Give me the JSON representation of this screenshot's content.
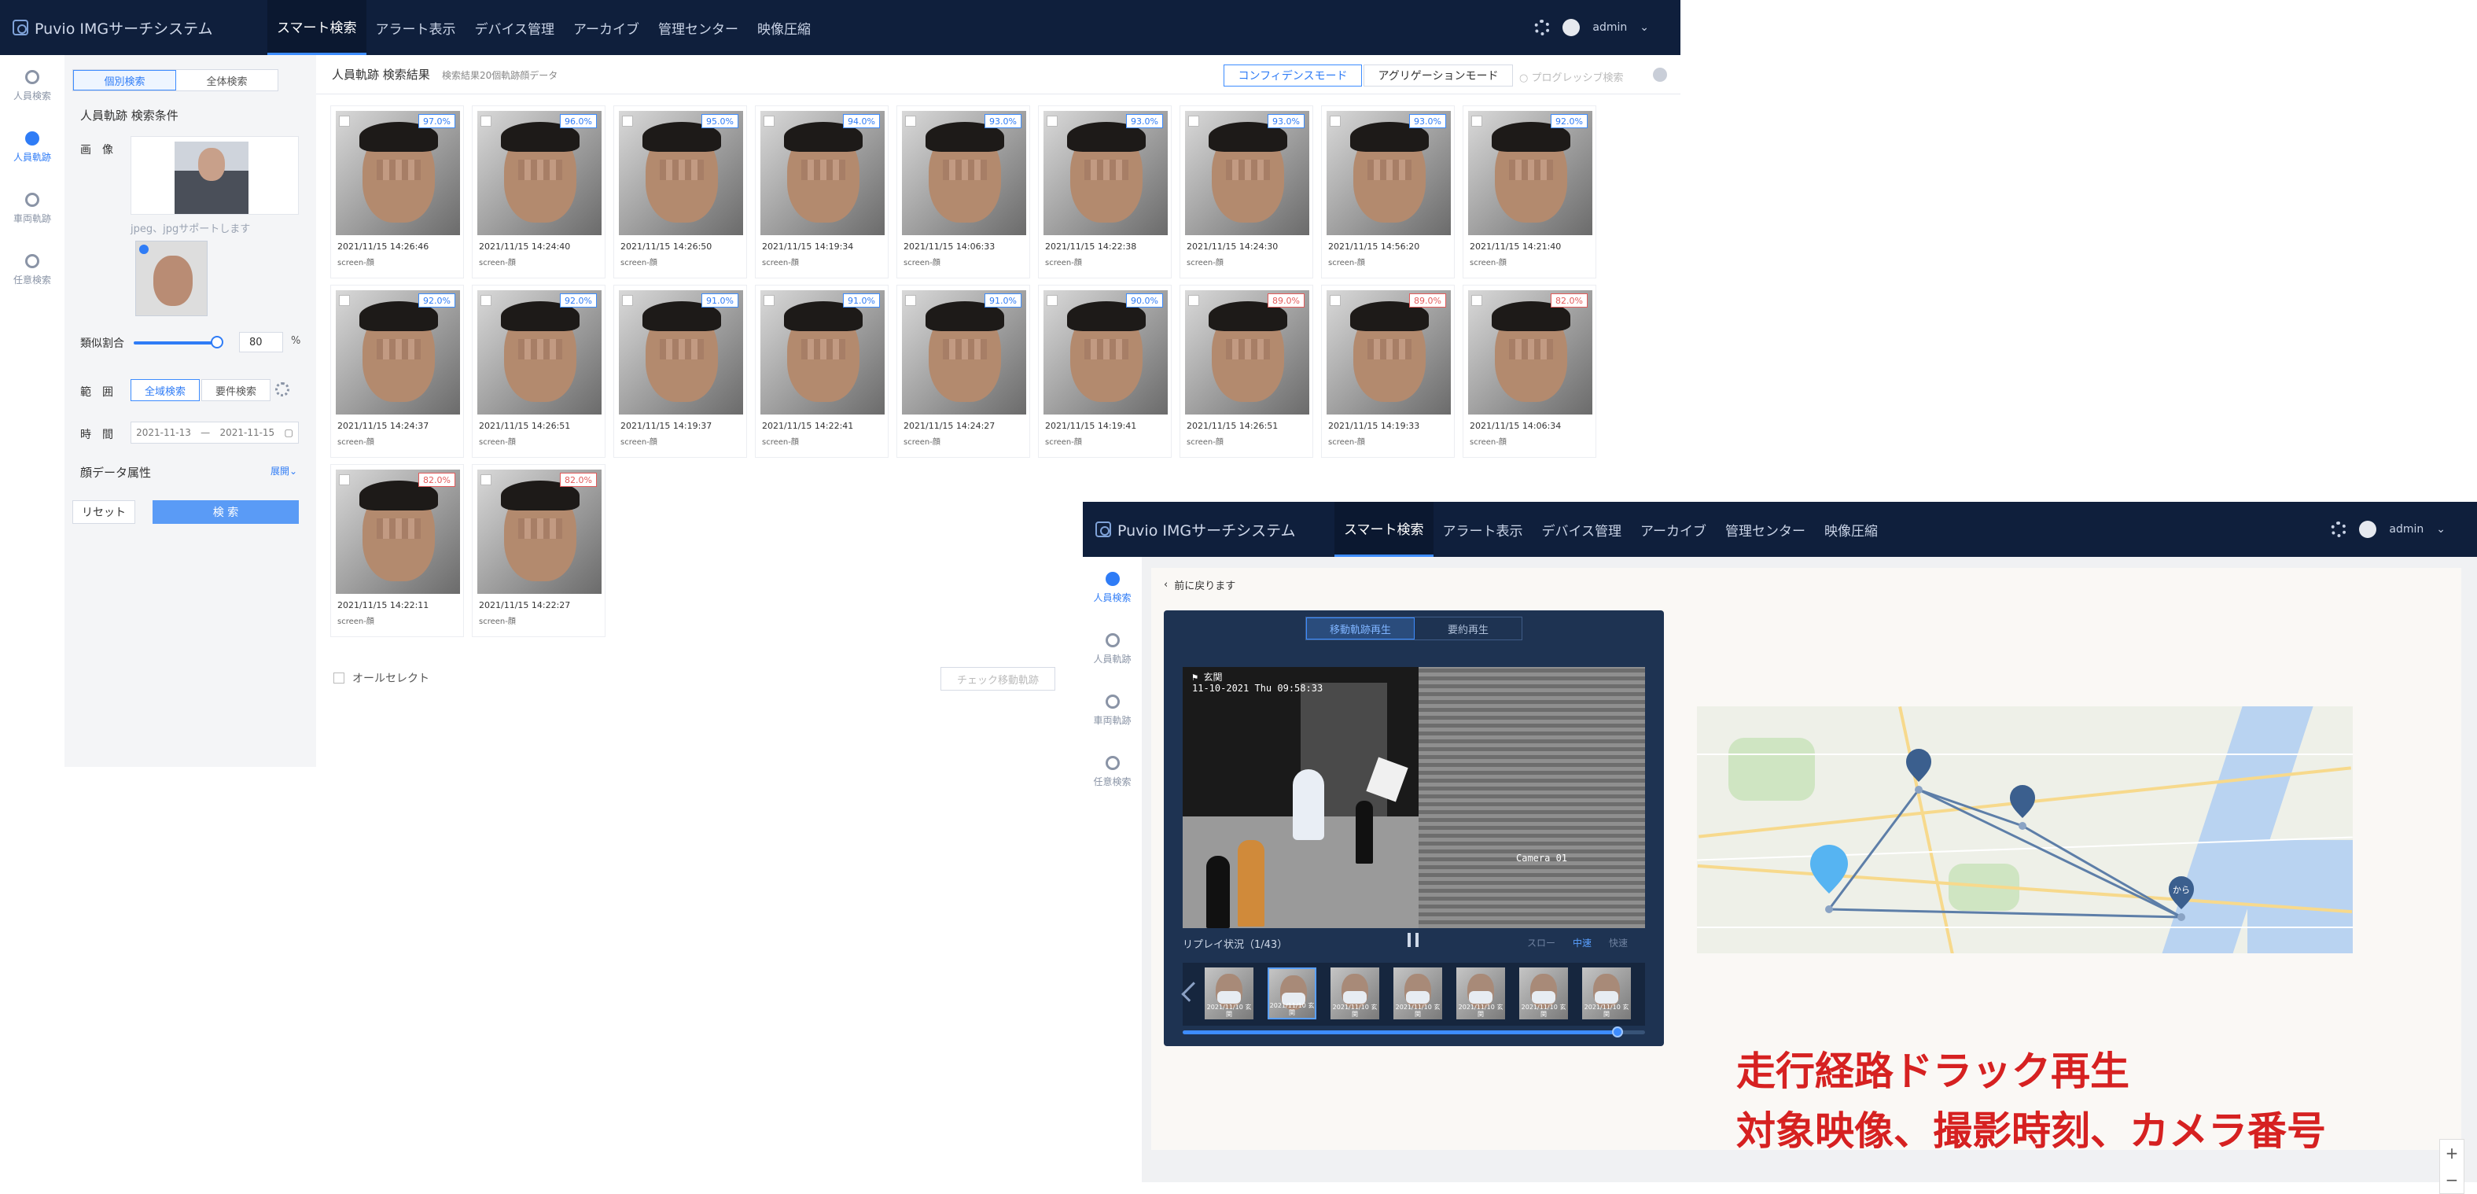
{
  "app": {
    "title": "Puvio IMGサーチシステム",
    "nav": [
      "スマート検索",
      "アラート表示",
      "デバイス管理",
      "アーカイブ",
      "管理センター",
      "映像圧縮"
    ],
    "user": "admin"
  },
  "window1": {
    "rail": [
      "人員検索",
      "人員軌跡",
      "車両軌跡",
      "任意検索"
    ],
    "panel": {
      "seg": [
        "個別検索",
        "全体検索"
      ],
      "section_title": "人員軌跡 検索条件",
      "image_label": "画　像",
      "format_hint": "jpeg、jpgサポートします",
      "similarity_label": "類似割合",
      "similarity_value": "80",
      "similarity_unit": "%",
      "range_label": "範　囲",
      "range_options": [
        "全域検索",
        "要件検索"
      ],
      "period_label": "時　間",
      "date_from": "2021-11-13",
      "date_sep": "—",
      "date_to": "2021-11-15",
      "attr_label": "顔データ属性",
      "attr_toggle": "展開",
      "reset": "リセット",
      "search": "検 索"
    },
    "header": {
      "title": "人員軌跡 検索結果",
      "subtitle": "検索結果20個軌跡顔データ",
      "mode_confidence": "コンフィデンスモード",
      "mode_aggregation": "アグリゲーションモード",
      "progressive": "プログレッシブ検索"
    },
    "results": [
      {
        "score": "97.0%",
        "time": "2021/11/15 14:26:46",
        "src": "screen-顔",
        "red": false
      },
      {
        "score": "96.0%",
        "time": "2021/11/15 14:24:40",
        "src": "screen-顔",
        "red": false
      },
      {
        "score": "95.0%",
        "time": "2021/11/15 14:26:50",
        "src": "screen-顔",
        "red": false
      },
      {
        "score": "94.0%",
        "time": "2021/11/15 14:19:34",
        "src": "screen-顔",
        "red": false
      },
      {
        "score": "93.0%",
        "time": "2021/11/15 14:06:33",
        "src": "screen-顔",
        "red": false
      },
      {
        "score": "93.0%",
        "time": "2021/11/15 14:22:38",
        "src": "screen-顔",
        "red": false
      },
      {
        "score": "93.0%",
        "time": "2021/11/15 14:24:30",
        "src": "screen-顔",
        "red": false
      },
      {
        "score": "93.0%",
        "time": "2021/11/15 14:56:20",
        "src": "screen-顔",
        "red": false
      },
      {
        "score": "92.0%",
        "time": "2021/11/15 14:21:40",
        "src": "screen-顔",
        "red": false
      },
      {
        "score": "92.0%",
        "time": "2021/11/15 14:24:37",
        "src": "screen-顔",
        "red": false
      },
      {
        "score": "92.0%",
        "time": "2021/11/15 14:26:51",
        "src": "screen-顔",
        "red": false
      },
      {
        "score": "91.0%",
        "time": "2021/11/15 14:19:37",
        "src": "screen-顔",
        "red": false
      },
      {
        "score": "91.0%",
        "time": "2021/11/15 14:22:41",
        "src": "screen-顔",
        "red": false
      },
      {
        "score": "91.0%",
        "time": "2021/11/15 14:24:27",
        "src": "screen-顔",
        "red": false
      },
      {
        "score": "90.0%",
        "time": "2021/11/15 14:19:41",
        "src": "screen-顔",
        "red": false
      },
      {
        "score": "89.0%",
        "time": "2021/11/15 14:26:51",
        "src": "screen-顔",
        "red": true
      },
      {
        "score": "89.0%",
        "time": "2021/11/15 14:19:33",
        "src": "screen-顔",
        "red": true
      },
      {
        "score": "82.0%",
        "time": "2021/11/15 14:06:34",
        "src": "screen-顔",
        "red": true
      },
      {
        "score": "82.0%",
        "time": "2021/11/15 14:22:11",
        "src": "screen-顔",
        "red": true
      },
      {
        "score": "82.0%",
        "time": "2021/11/15 14:22:27",
        "src": "screen-顔",
        "red": true
      }
    ],
    "select_all": "オールセレクト",
    "check_button": "チェック移動軌跡"
  },
  "window2": {
    "rail": [
      "人員検索",
      "人員軌跡",
      "車両軌跡",
      "任意検索"
    ],
    "back": "前に戻ります",
    "tabs": [
      "移動軌跡再生",
      "要約再生"
    ],
    "video": {
      "camera": "玄関",
      "datetime": "11-10-2021 Thu 09:58:33",
      "camera_label": "Camera 01"
    },
    "replay_status": "リプレイ状況（1/43）",
    "speeds": [
      "スロー",
      "中速",
      "快速"
    ],
    "strip_captions": [
      "2021/11/10 玄関",
      "2021/11/10 玄関",
      "2021/11/10 玄関",
      "2021/11/10 玄関",
      "2021/11/10 玄関",
      "2021/11/10 玄関",
      "2021/11/10 玄関"
    ],
    "progress": 0.94,
    "map_pin_label": "から",
    "annotation1": "走行経路ドラック再生",
    "annotation2": "対象映像、撮影時刻、カメラ番号",
    "zoom_in": "+",
    "zoom_out": "−"
  }
}
